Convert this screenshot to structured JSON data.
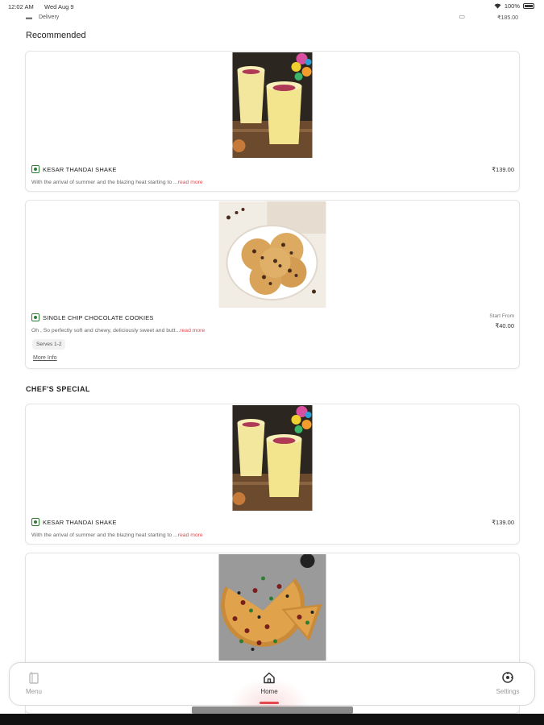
{
  "status_bar": {
    "time": "12:02 AM",
    "date": "Wed Aug 9",
    "battery": "100%"
  },
  "header": {
    "delivery_label": "Delivery",
    "amount": "₹185.00"
  },
  "sections": {
    "recommended": "Recommended",
    "chefs_special": "CHEF'S SPECIAL"
  },
  "items": [
    {
      "name": "KESAR THANDAI SHAKE",
      "price": "₹139.00",
      "desc": "With the arrival of summer and the blazing heat starting to ...",
      "read_more": "read more"
    },
    {
      "name": "SINGLE CHIP CHOCOLATE COOKIES",
      "start_from": "Start From",
      "price": "₹40.00",
      "desc": "Oh , So perfectly soft and chewy, deliciously sweet and butt...",
      "read_more": "read more",
      "serves": "Serves 1-2",
      "more_info": "More Info"
    },
    {
      "name": "KESAR THANDAI SHAKE",
      "price": "₹139.00",
      "desc": "With the arrival of summer and the blazing heat starting to ...",
      "read_more": "read more"
    }
  ],
  "nav": {
    "menu": "Menu",
    "home": "Home",
    "settings": "Settings"
  },
  "colors": {
    "accent": "#e5484d",
    "veg": "#2e7d32"
  },
  "icons": {
    "menu": "menu-book-icon",
    "home": "home-icon",
    "settings": "settings-icon"
  }
}
